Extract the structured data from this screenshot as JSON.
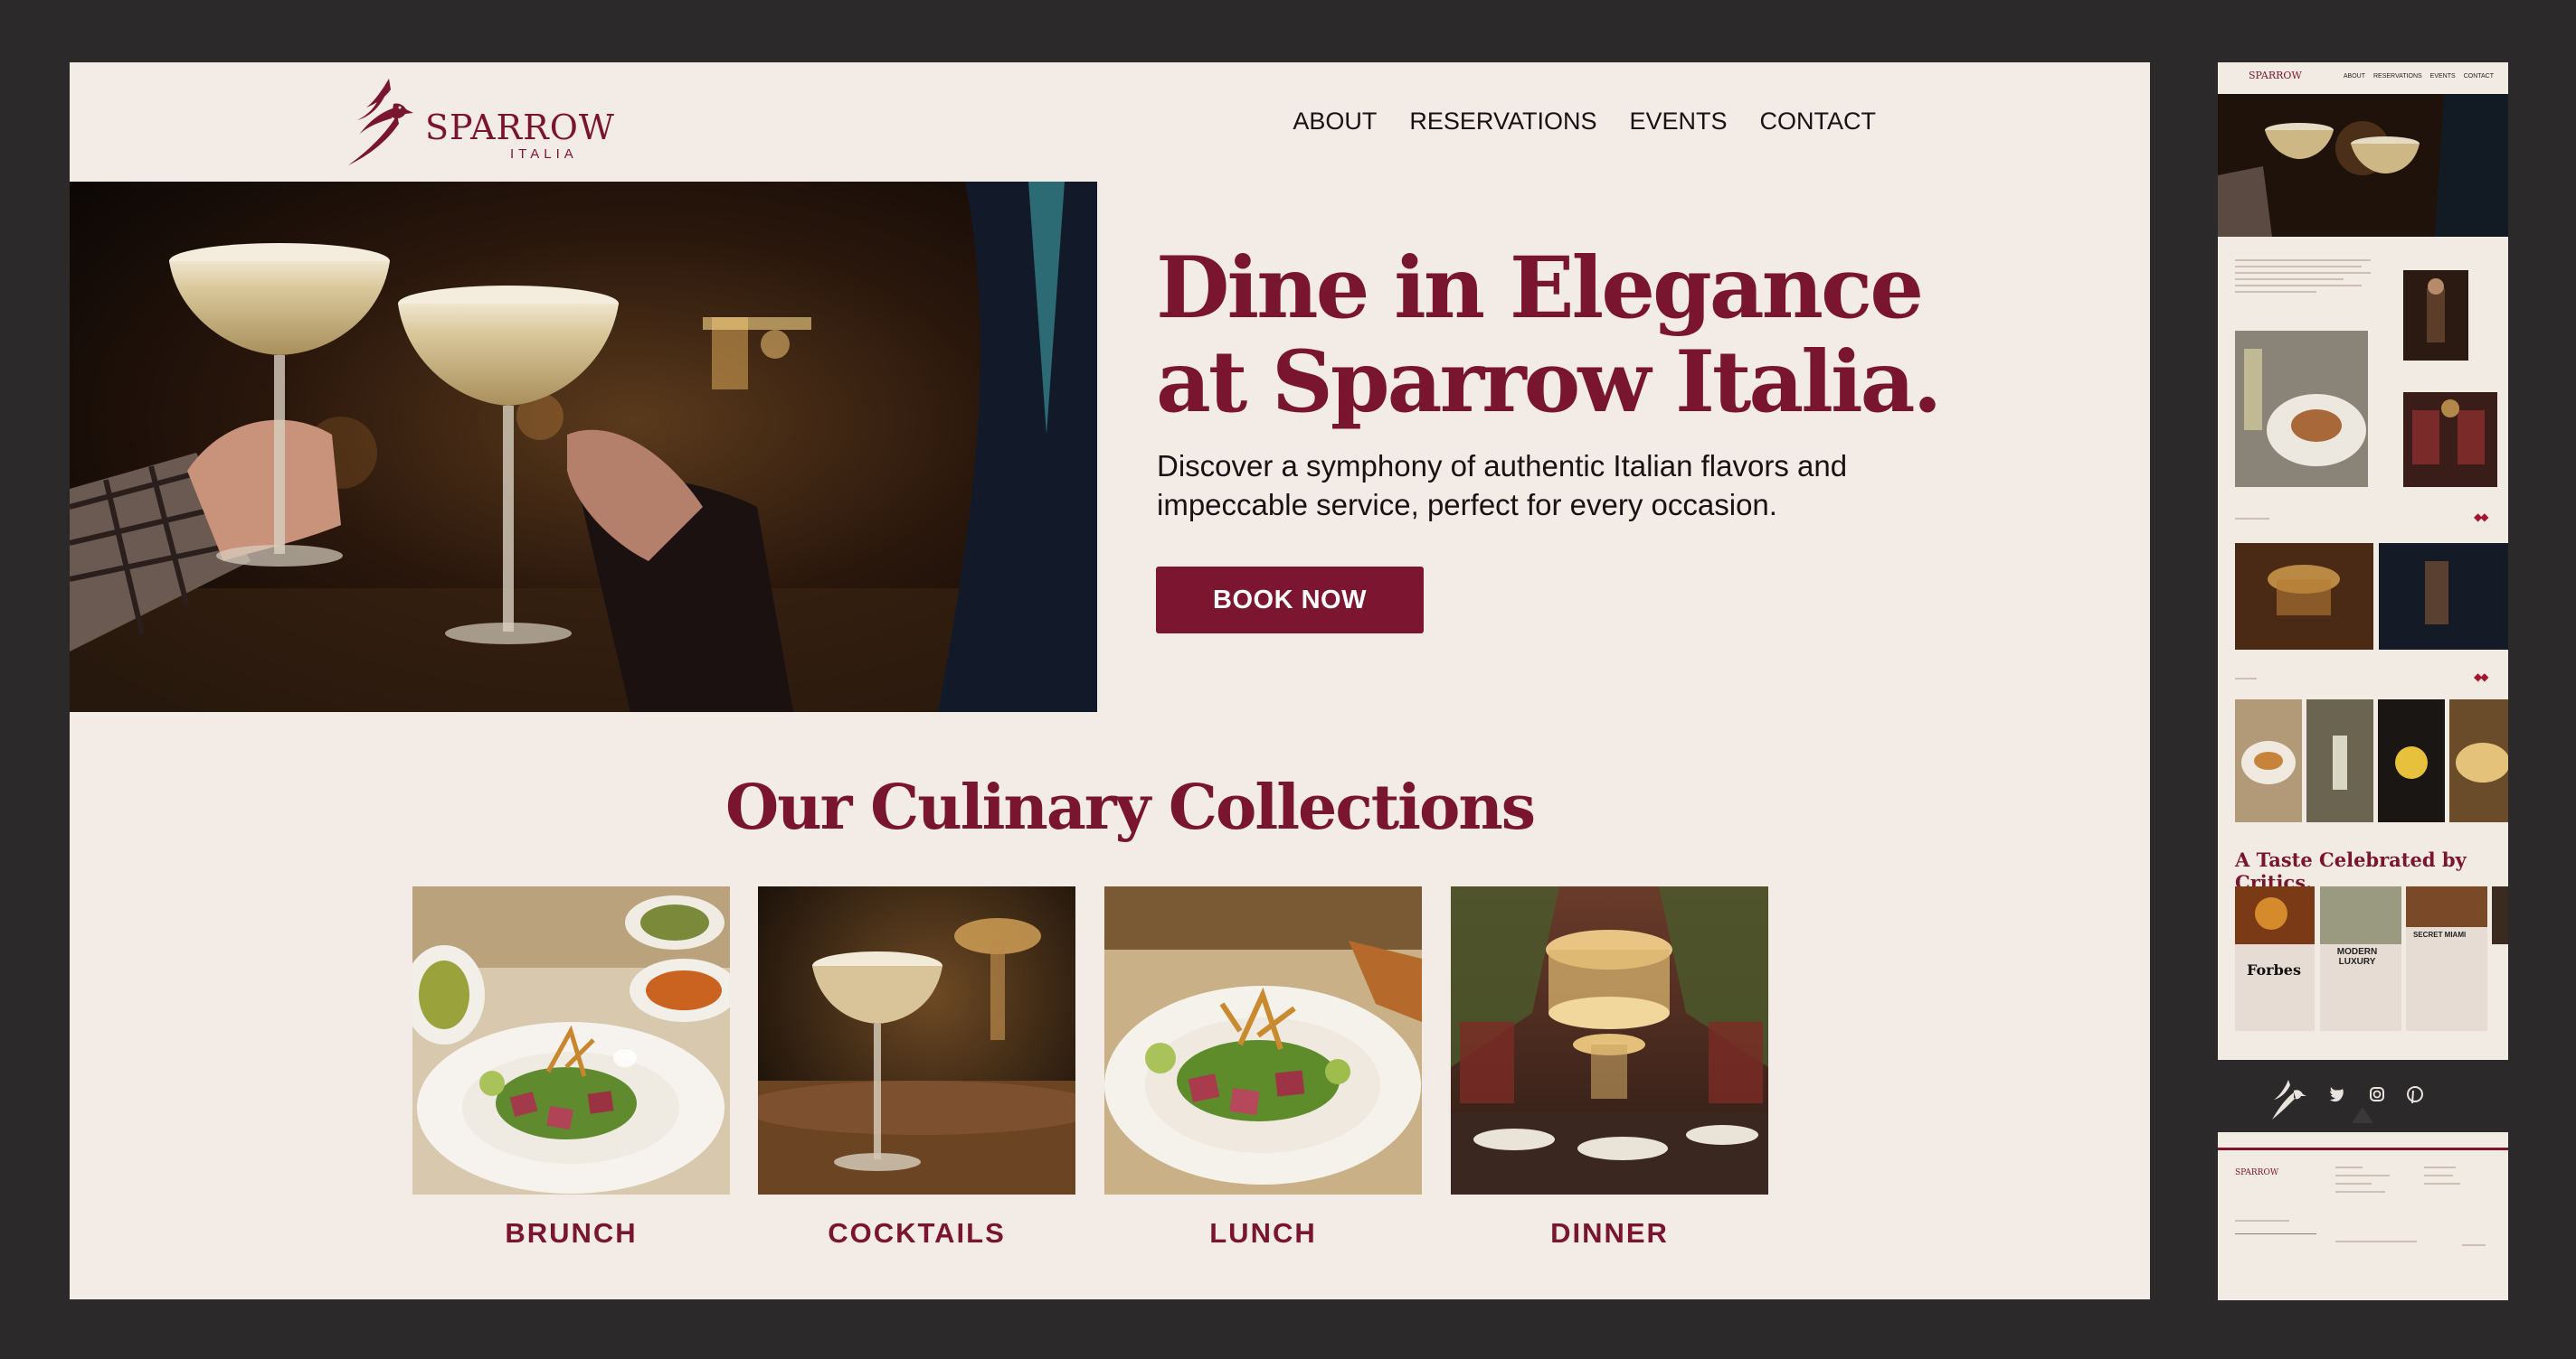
{
  "brand": {
    "name": "SPARROW",
    "sub": "ITALIA"
  },
  "nav": {
    "about": "ABOUT",
    "reservations": "RESERVATIONS",
    "events": "EVENTS",
    "contact": "CONTACT"
  },
  "hero": {
    "title_line1": "Dine in Elegance",
    "title_line2": "at Sparrow Italia.",
    "subtitle": "Discover a symphony of authentic Italian flavors and impeccable service, perfect for every occasion.",
    "cta": "BOOK NOW"
  },
  "collections": {
    "title": "Our Culinary Collections",
    "items": [
      {
        "label": "BRUNCH"
      },
      {
        "label": "COCKTAILS"
      },
      {
        "label": "LUNCH"
      },
      {
        "label": "DINNER"
      }
    ]
  },
  "preview": {
    "nav": [
      "ABOUT",
      "RESERVATIONS",
      "EVENTS",
      "CONTACT"
    ],
    "logo": "SPARROW",
    "critics_title": "A Taste Celebrated by Critics.",
    "press": [
      "Forbes",
      "MODERN LUXURY",
      "SECRET MIAMI"
    ]
  },
  "colors": {
    "brand": "#7a1530",
    "background": "#f3ebe5",
    "frame": "#2b2929"
  }
}
